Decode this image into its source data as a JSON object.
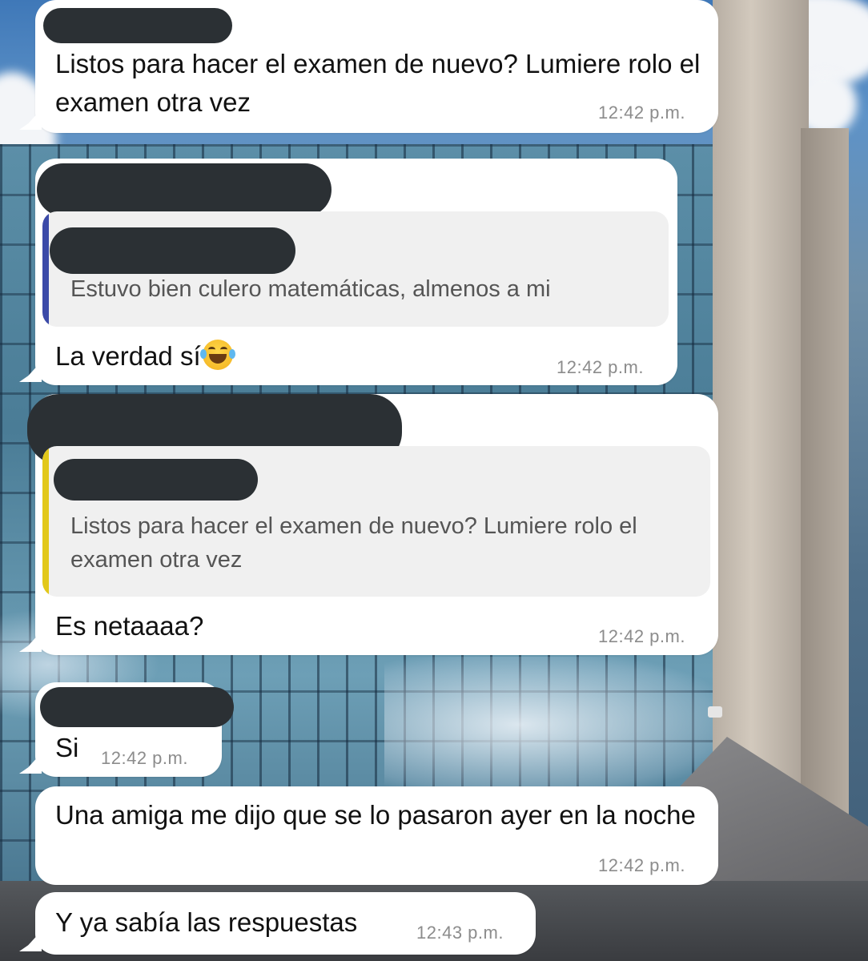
{
  "messages": [
    {
      "text": "Listos para hacer el examen de nuevo? Lumiere rolo el examen otra vez",
      "time": "12:42 p.m."
    },
    {
      "quoted_text": "Estuvo bien culero matemáticas, almenos a mi",
      "quote_bar_color": "#3b4aa8",
      "text": "La verdad sí",
      "emoji": "face-with-tears-of-joy-icon",
      "time": "12:42 p.m."
    },
    {
      "quoted_text": "Listos para hacer el examen de nuevo? Lumiere rolo el examen otra vez",
      "quote_bar_color": "#e2c81a",
      "text": "Es netaaaa?",
      "time": "12:42 p.m."
    },
    {
      "text": "Si",
      "time": "12:42 p.m."
    },
    {
      "text": "Una amiga me dijo que se lo pasaron ayer en la noche",
      "time": "12:42 p.m."
    },
    {
      "text": "Y ya sabía las respuestas",
      "time": "12:43 p.m."
    }
  ],
  "colors": {
    "bubble": "#ffffff",
    "redaction": "#2b3034",
    "timestamp": "#8c8c8c",
    "quote_background": "#f0f0f0"
  }
}
